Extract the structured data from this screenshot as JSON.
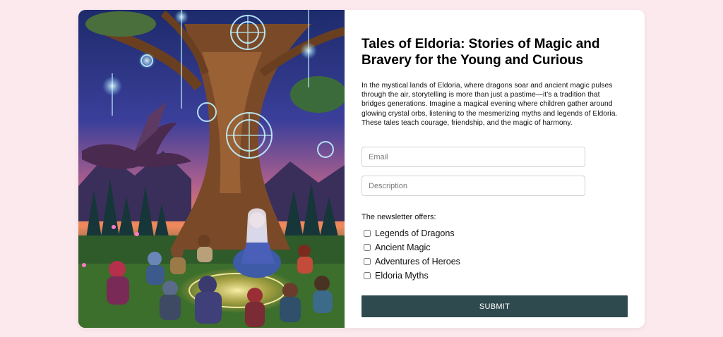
{
  "article": {
    "title": "Tales of Eldoria: Stories of Magic and Bravery for the Young and Curious",
    "description": "In the mystical lands of Eldoria, where dragons soar and ancient magic pulses through the air, storytelling is more than just a pastime—it’s a tradition that bridges generations. Imagine a magical evening where children gather around glowing crystal orbs, listening to the mesmerizing myths and legends of Eldoria. These tales teach courage, friendship, and the magic of harmony."
  },
  "form": {
    "email_placeholder": "Email",
    "description_placeholder": "Description",
    "offers_label": "The newsletter offers:",
    "options": [
      {
        "label": "Legends of Dragons",
        "checked": false
      },
      {
        "label": "Ancient Magic",
        "checked": false
      },
      {
        "label": "Adventures of Heroes",
        "checked": false
      },
      {
        "label": "Eldoria Myths",
        "checked": false
      }
    ],
    "submit_label": "SUBMIT"
  },
  "colors": {
    "page_background": "#fbe9ee",
    "submit_background": "#2f4a4f"
  }
}
